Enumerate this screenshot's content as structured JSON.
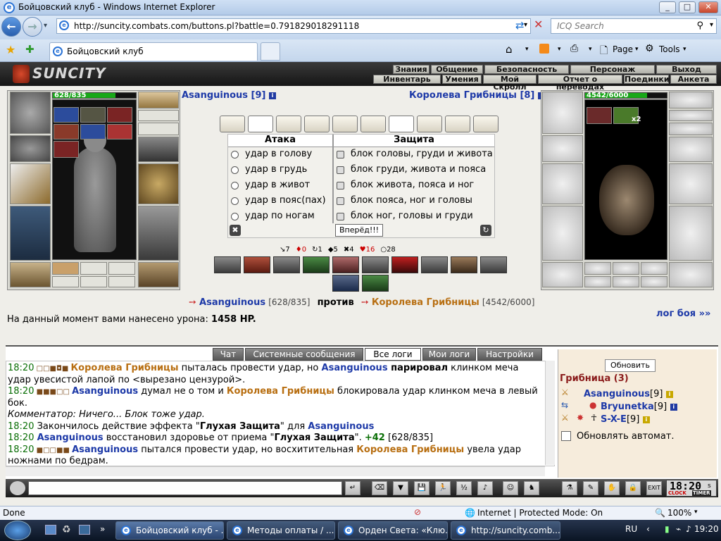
{
  "window": {
    "title": "Бойцовский клуб - Windows Internet Explorer",
    "controls": [
      "_",
      "□",
      "✕"
    ]
  },
  "navigation": {
    "url": "http://suncity.combats.com/buttons.pl?battle=0.791829018291118",
    "search_placeholder": "ICQ Search"
  },
  "browser_tab": {
    "label": "Бойцовский клуб"
  },
  "commands": {
    "page": "Page",
    "tools": "Tools"
  },
  "game": {
    "logo": "SUNCITY",
    "menu_top": [
      "Знания",
      "Общение",
      "Безопасность",
      "Персонаж",
      "Выход"
    ],
    "menu_bottom": [
      "Инвентарь",
      "Умения",
      "Мой Скролл",
      "Отчет о переводах",
      "Поединки",
      "Анкета"
    ],
    "player": {
      "name": "Asanguinous [9]",
      "hp_text": "628/835",
      "hp_fraction": 0.752
    },
    "enemy": {
      "name": "Королева Грибницы [8]",
      "hp_text": "4542/6000",
      "hp_fraction": 0.757,
      "multiplier": "x2"
    },
    "attack_header": "Атака",
    "defense_header": "Защита",
    "attacks": [
      "удар в голову",
      "удар в грудь",
      "удар в живот",
      "удар в пояс(пах)",
      "удар по ногам"
    ],
    "defenses": [
      "блок головы, груди и живота",
      "блок груди, живота и пояса",
      "блок живота, пояса и ног",
      "блок пояса, ног и головы",
      "блок ног, головы и груди"
    ],
    "forward_button": "Вперёд!!!",
    "stats": [
      "↘7",
      "♦0",
      "↻1",
      "◆5",
      "✖4",
      "♥16",
      "○28"
    ],
    "versus": {
      "player": "Asanguinous",
      "player_hp": "[628/835]",
      "word": "против",
      "enemy": "Королева Грибницы",
      "enemy_hp": "[4542/6000]"
    },
    "damage": {
      "label": "На данный момент вами нанесено урона:",
      "value": "1458 HP."
    },
    "log_link": "лог боя »»"
  },
  "chat": {
    "tabs": [
      "Чат",
      "Системные сообщения",
      "Все логи",
      "Мои логи",
      "Настройки"
    ],
    "active_tab": "Все логи",
    "lines": [
      {
        "time": "18:20",
        "icons": "□□■◘■",
        "parts": [
          {
            "t": "Королева Грибницы",
            "c": "gold"
          },
          {
            "t": " пыталась провести удар, но "
          },
          {
            "t": "Asanguinous",
            "c": "blue"
          },
          {
            "t": " парировал",
            "c": "bold"
          },
          {
            "t": " клинком меча"
          }
        ]
      },
      {
        "time": "",
        "icons": "",
        "parts": [
          {
            "t": "удар увесистой лапой по <вырезано цензурой>."
          }
        ]
      },
      {
        "time": "18:20",
        "icons": "■■■□□",
        "parts": [
          {
            "t": "Asanguinous",
            "c": "blue"
          },
          {
            "t": " думал не о том и "
          },
          {
            "t": "Королева Грибницы",
            "c": "gold"
          },
          {
            "t": " блокировала удар клинком меча в левый"
          }
        ]
      },
      {
        "time": "",
        "icons": "",
        "parts": [
          {
            "t": "бок."
          }
        ]
      },
      {
        "time": "",
        "icons": "",
        "parts": [
          {
            "t": "Комментатор: Ничего... Блок тоже удар.",
            "c": "italic"
          }
        ]
      },
      {
        "time": "18:20",
        "icons": "",
        "parts": [
          {
            "t": " Закончилось действие эффекта \""
          },
          {
            "t": "Глухая Защита",
            "c": "bold"
          },
          {
            "t": "\" для "
          },
          {
            "t": "Asanguinous",
            "c": "blue"
          }
        ]
      },
      {
        "time": "18:20",
        "icons": "",
        "parts": [
          {
            "t": " "
          },
          {
            "t": "Asanguinous",
            "c": "blue"
          },
          {
            "t": " восстановил здоровье от приема \""
          },
          {
            "t": "Глухая Защита",
            "c": "bold"
          },
          {
            "t": "\". "
          },
          {
            "t": "+42",
            "c": "green"
          },
          {
            "t": " [628/835]"
          }
        ]
      },
      {
        "time": "18:20",
        "icons": "■□□■■",
        "parts": [
          {
            "t": "Asanguinous",
            "c": "blue"
          },
          {
            "t": " пытался провести удар, но восхитительная "
          },
          {
            "t": "Королева Грибницы",
            "c": "gold"
          },
          {
            "t": " увела удар"
          }
        ]
      },
      {
        "time": "",
        "icons": "",
        "parts": [
          {
            "t": "ножнами по бедрам."
          }
        ]
      }
    ]
  },
  "side_panel": {
    "refresh": "Обновить",
    "group": "Грибница (3)",
    "members": [
      {
        "name": "Asanguinous",
        "level": "[9]"
      },
      {
        "name": "Bryunetka",
        "level": "[9]"
      },
      {
        "name": "S-X-E",
        "level": "[9]"
      }
    ],
    "auto_refresh": "Обновлять автомат."
  },
  "clock": {
    "time": "18:20",
    "s": "s",
    "clock_label": "CLOCK",
    "timer_label": "TIMER",
    "exit": "EXIT"
  },
  "status_bar": {
    "text": "Done",
    "zone": "Internet | Protected Mode: On",
    "zoom": "100%"
  },
  "taskbar": {
    "buttons": [
      "Бойцовский клуб - ...",
      "Методы оплаты / ...",
      "Орден Света: «Клю...",
      "http://suncity.comb..."
    ],
    "lang": "RU",
    "time": "19:20"
  },
  "colors": {
    "player": "#1e3aa8",
    "enemy": "#b86f12",
    "time": "#096e05",
    "hp_green": "#18a818"
  }
}
